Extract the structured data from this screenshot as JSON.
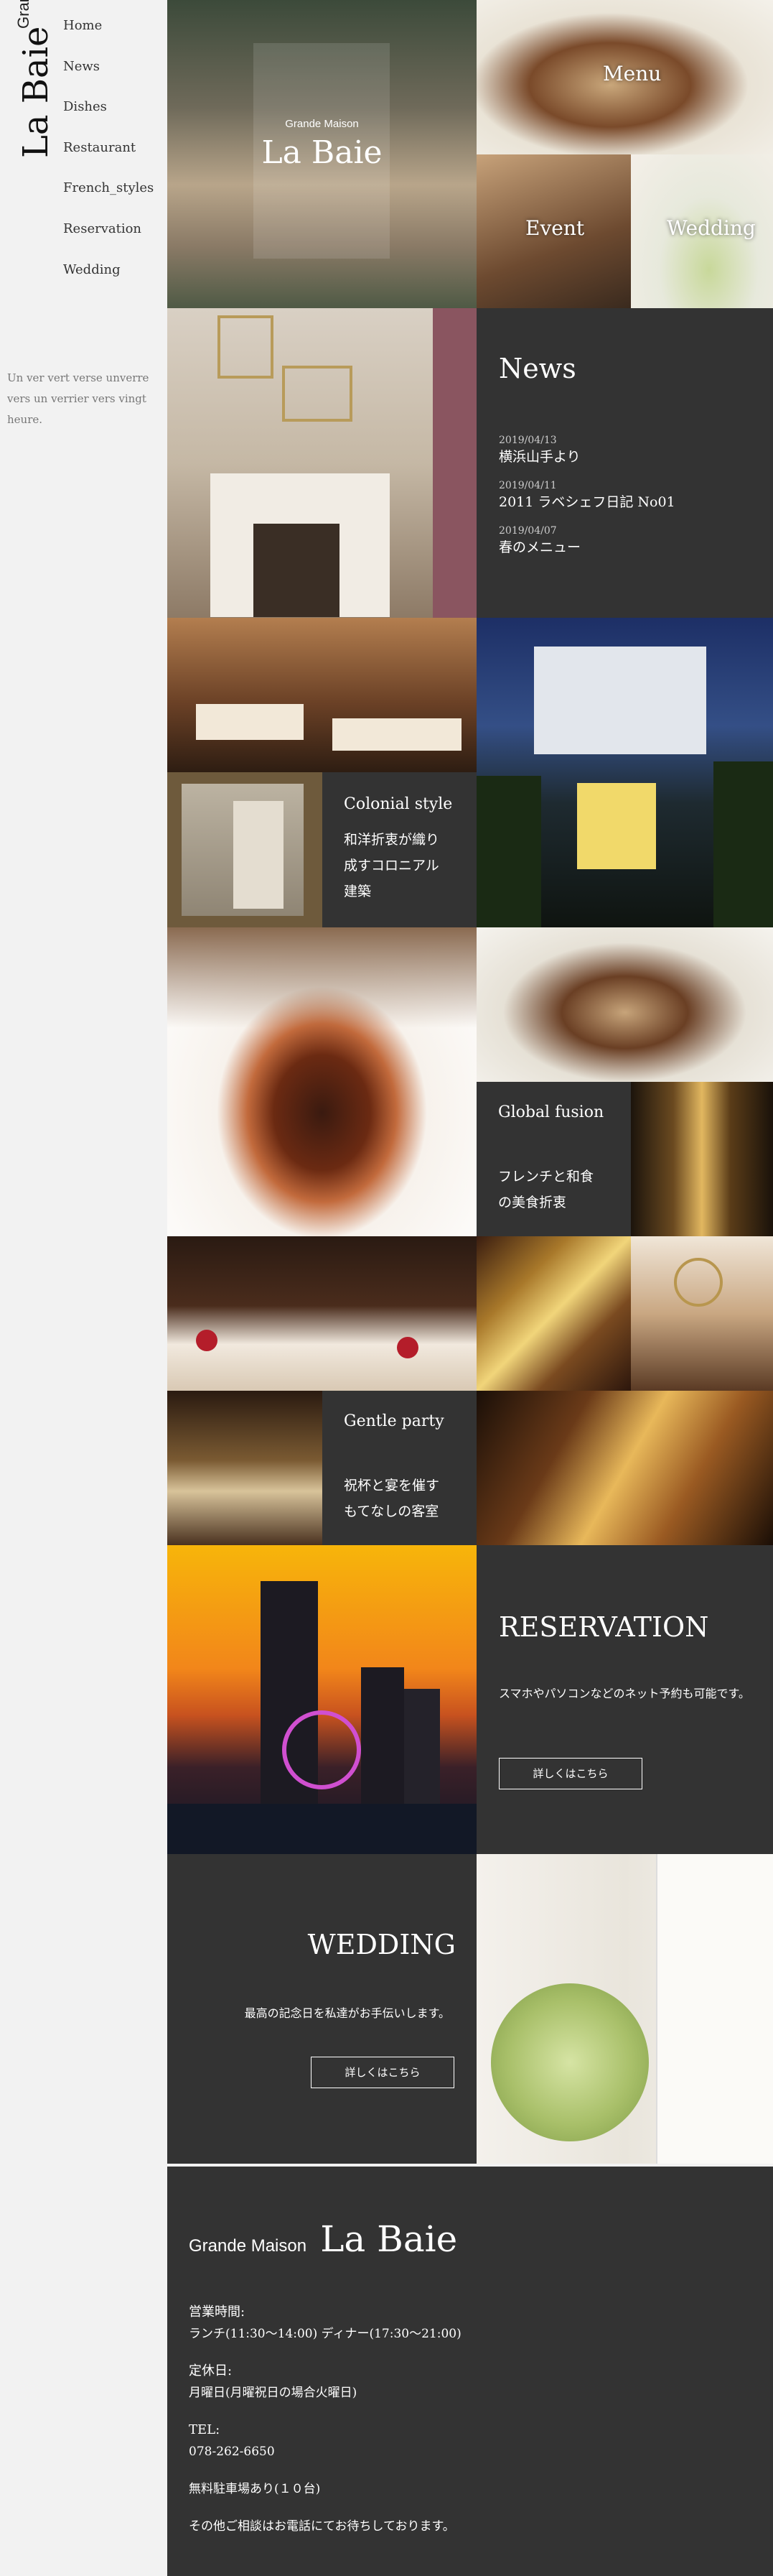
{
  "brand": {
    "prefix": "Grande Maison",
    "name": "La Baie"
  },
  "nav": {
    "items": [
      {
        "label": "Home"
      },
      {
        "label": "News"
      },
      {
        "label": "Dishes"
      },
      {
        "label": "Restaurant"
      },
      {
        "label": "French_styles"
      },
      {
        "label": "Reservation"
      },
      {
        "label": "Wedding"
      }
    ]
  },
  "tagline": "Un ver vert verse unverre vers un verrier vers vingt heure.",
  "hero": {
    "prefix": "Grande Maison",
    "name": "La Baie"
  },
  "tiles": {
    "menu": "Menu",
    "event": "Event",
    "wedding": "Wedding"
  },
  "news": {
    "heading": "News",
    "items": [
      {
        "date": "2019/04/13",
        "title": "横浜山手より"
      },
      {
        "date": "2019/04/11",
        "title": "2011 ラベシェフ日記 No01"
      },
      {
        "date": "2019/04/07",
        "title": "春のメニュー"
      }
    ]
  },
  "colonial": {
    "heading": "Colonial style",
    "text": "和洋折衷が織り成すコロニアル建築"
  },
  "fusion": {
    "heading": "Global fusion",
    "text": "フレンチと和食の美食折衷"
  },
  "party": {
    "heading": "Gentle party",
    "text": "祝杯と宴を催すもてなしの客室"
  },
  "reservation": {
    "heading": "RESERVATION",
    "text": "スマホやパソコンなどのネット予約も可能です。",
    "button": "詳しくはこちら"
  },
  "wedding": {
    "heading": "WEDDING",
    "text": "最高の記念日を私達がお手伝いします。",
    "button": "詳しくはこちら"
  },
  "footer": {
    "prefix": "Grande Maison",
    "name": "La Baie",
    "hours_label": "営業時間:",
    "hours": "ランチ(11:30〜14:00) ディナー(17:30〜21:00)",
    "closed_label": "定休日:",
    "closed": "月曜日(月曜祝日の場合火曜日)",
    "tel_label": "TEL:",
    "tel": "078-262-6650",
    "parking": "無料駐車場あり(１０台)",
    "consult": "その他ご相談はお電話にてお待ちしております。"
  },
  "colors": {
    "dark_panel": "#333333",
    "sidebar_bg": "#f2f2f2"
  }
}
